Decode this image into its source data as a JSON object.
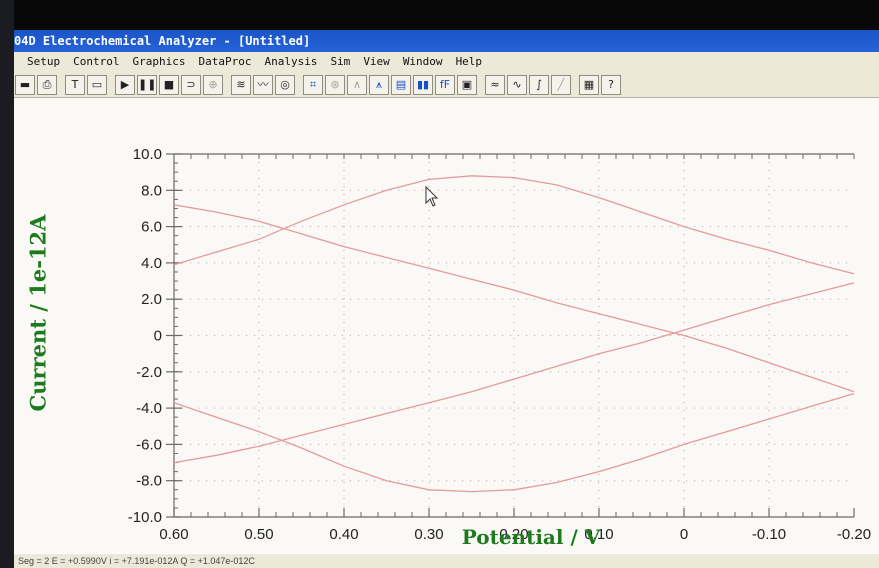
{
  "window": {
    "title": "04D Electrochemical Analyzer - [Untitled]"
  },
  "menu": {
    "items": [
      "Setup",
      "Control",
      "Graphics",
      "DataProc",
      "Analysis",
      "Sim",
      "View",
      "Window",
      "Help"
    ]
  },
  "toolbar": {
    "buttons": [
      {
        "name": "save-icon",
        "glyph": "▬"
      },
      {
        "name": "print-icon",
        "glyph": "⎙"
      },
      {
        "name": "text-icon",
        "glyph": "T"
      },
      {
        "name": "frame-icon",
        "glyph": "▭"
      },
      {
        "name": "run-icon",
        "glyph": "▶"
      },
      {
        "name": "pause-icon",
        "glyph": "❚❚"
      },
      {
        "name": "stop-icon",
        "glyph": "■"
      },
      {
        "name": "reverse-icon",
        "glyph": "⊃"
      },
      {
        "name": "target-icon",
        "glyph": "⊕"
      },
      {
        "name": "scan-icon",
        "glyph": "≋"
      },
      {
        "name": "wave-icon",
        "glyph": "〰"
      },
      {
        "name": "dial-icon",
        "glyph": "◎"
      },
      {
        "name": "graph-icon",
        "glyph": "⌗"
      },
      {
        "name": "zoom-icon",
        "glyph": "⊛"
      },
      {
        "name": "peak-icon",
        "glyph": "∧"
      },
      {
        "name": "tree-icon",
        "glyph": "⩚"
      },
      {
        "name": "data-icon",
        "glyph": "▤"
      },
      {
        "name": "color-bars-icon",
        "glyph": "▮▮"
      },
      {
        "name": "function-icon",
        "glyph": "fF"
      },
      {
        "name": "clipboard-icon",
        "glyph": "▣"
      },
      {
        "name": "smooth-icon",
        "glyph": "≈"
      },
      {
        "name": "derivative-icon",
        "glyph": "∿"
      },
      {
        "name": "integral-icon",
        "glyph": "∫"
      },
      {
        "name": "line-icon",
        "glyph": "╱"
      },
      {
        "name": "calculator-icon",
        "glyph": "▦"
      },
      {
        "name": "help-icon",
        "glyph": "?"
      }
    ]
  },
  "statusbar": {
    "text": "Seg = 2  E = +0.5990V  i = +7.191e-012A  Q = +1.047e-012C"
  },
  "colors": {
    "curve": "#e59a9a",
    "axis": "#6a6a6a",
    "tick_label": "#222222",
    "axis_title": "#1e7a1e",
    "grid": "#a8a8a8"
  },
  "chart_data": {
    "type": "line",
    "title": "",
    "xlabel": "Potential / V",
    "ylabel": "Current / 1e-12A",
    "xlim": [
      0.6,
      -0.2
    ],
    "ylim": [
      -10.0,
      10.0
    ],
    "x_direction": "decreasing to the right",
    "x_ticks": [
      "0.60",
      "0.50",
      "0.40",
      "0.30",
      "0.20",
      "0.10",
      "0",
      "-0.10",
      "-0.20"
    ],
    "y_ticks": [
      "10.0",
      "8.0",
      "6.0",
      "4.0",
      "2.0",
      "0",
      "-2.0",
      "-4.0",
      "-6.0",
      "-8.0",
      "-10.0"
    ],
    "grid": "dotted",
    "series": [
      {
        "x": [
          0.6,
          0.55,
          0.5,
          0.45,
          0.4,
          0.35,
          0.3,
          0.25,
          0.2,
          0.15,
          0.1,
          0.05,
          0.0,
          -0.05,
          -0.1,
          -0.15,
          -0.2
        ],
        "y": [
          3.9,
          4.6,
          5.3,
          6.3,
          7.2,
          8.0,
          8.6,
          8.8,
          8.7,
          8.3,
          7.6,
          6.8,
          6.0,
          5.3,
          4.7,
          4.0,
          3.4
        ]
      },
      {
        "x": [
          0.6,
          0.55,
          0.5,
          0.45,
          0.4,
          0.35,
          0.3,
          0.25,
          0.2,
          0.15,
          0.1,
          0.05,
          0.0,
          -0.05,
          -0.1,
          -0.15,
          -0.2
        ],
        "y": [
          7.2,
          6.8,
          6.3,
          5.6,
          4.9,
          4.3,
          3.7,
          3.1,
          2.5,
          1.8,
          1.2,
          0.6,
          0.0,
          -0.7,
          -1.5,
          -2.3,
          -3.1
        ]
      },
      {
        "x": [
          0.6,
          0.55,
          0.5,
          0.45,
          0.4,
          0.35,
          0.3,
          0.25,
          0.2,
          0.15,
          0.1,
          0.05,
          0.0,
          -0.05,
          -0.1,
          -0.15,
          -0.2
        ],
        "y": [
          -7.0,
          -6.6,
          -6.1,
          -5.5,
          -4.9,
          -4.3,
          -3.7,
          -3.1,
          -2.4,
          -1.7,
          -1.0,
          -0.4,
          0.3,
          1.0,
          1.7,
          2.3,
          2.9
        ]
      },
      {
        "x": [
          0.6,
          0.55,
          0.5,
          0.45,
          0.4,
          0.35,
          0.3,
          0.25,
          0.2,
          0.15,
          0.1,
          0.05,
          0.0,
          -0.05,
          -0.1,
          -0.15,
          -0.2
        ],
        "y": [
          -3.7,
          -4.5,
          -5.3,
          -6.2,
          -7.2,
          -8.0,
          -8.5,
          -8.6,
          -8.5,
          -8.1,
          -7.5,
          -6.8,
          -6.0,
          -5.3,
          -4.6,
          -3.9,
          -3.2
        ]
      }
    ]
  }
}
